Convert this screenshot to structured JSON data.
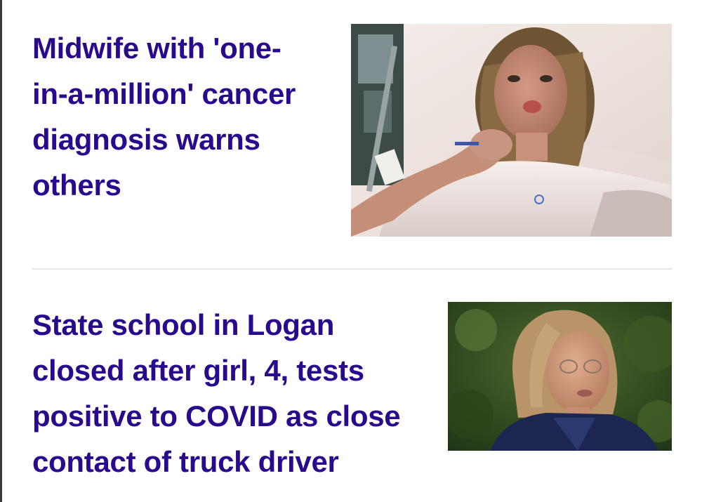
{
  "feed": {
    "stories": [
      {
        "headline_lines": [
          "Midwife with 'one-",
          "in-a-million' cancer",
          "diagnosis warns",
          "others"
        ],
        "image_alt": "woman-in-hospital-bed-photo"
      },
      {
        "headline_lines": [
          "State school in Logan",
          "closed after girl, 4, tests",
          "positive to COVID as close",
          "contact of truck driver"
        ],
        "image_alt": "woman-speaking-outdoors-photo"
      }
    ],
    "colors": {
      "headline": "#2a0a8c",
      "divider": "#e4e4ea"
    }
  }
}
